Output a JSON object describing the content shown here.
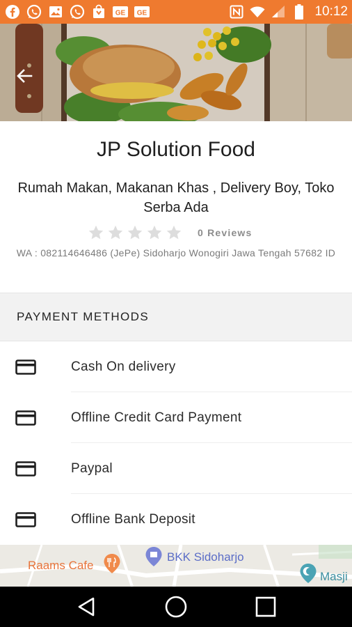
{
  "status_bar": {
    "time": "10:12",
    "background": "#ef7a2f",
    "left_icons": [
      "facebook-icon",
      "whatsapp-icon",
      "gallery-icon",
      "whatsapp-icon",
      "shopping-bag-icon",
      "ge-icon",
      "ge-icon"
    ],
    "right_icons": [
      "nfc-icon",
      "wifi-icon",
      "signal-icon",
      "battery-icon"
    ],
    "ge_label": "GE"
  },
  "store": {
    "name": "JP Solution Food",
    "categories": "Rumah Makan, Makanan Khas , Delivery Boy, Toko Serba Ada",
    "rating": 0,
    "rating_max": 5,
    "reviews_label": "0 Reviews",
    "address": "WA : 082114646486 (JePe) Sidoharjo Wonogiri Jawa Tengah 57682 ID"
  },
  "payment": {
    "header": "PAYMENT METHODS",
    "methods": [
      {
        "label": "Cash On delivery",
        "icon": "credit-card-icon"
      },
      {
        "label": "Offline Credit Card Payment",
        "icon": "credit-card-icon"
      },
      {
        "label": "Paypal",
        "icon": "credit-card-icon"
      },
      {
        "label": "Offline Bank Deposit",
        "icon": "credit-card-icon"
      }
    ]
  },
  "map": {
    "place_1": "Raams Cafe",
    "place_2": "BKK Sidoharjo",
    "place_3": "Masji",
    "place_1_color": "#e8743b",
    "place_2_color": "#5b6dc7",
    "place_3_color": "#3c8fa0"
  },
  "colors": {
    "accent": "#ef7a2f",
    "navbar": "#000000"
  }
}
